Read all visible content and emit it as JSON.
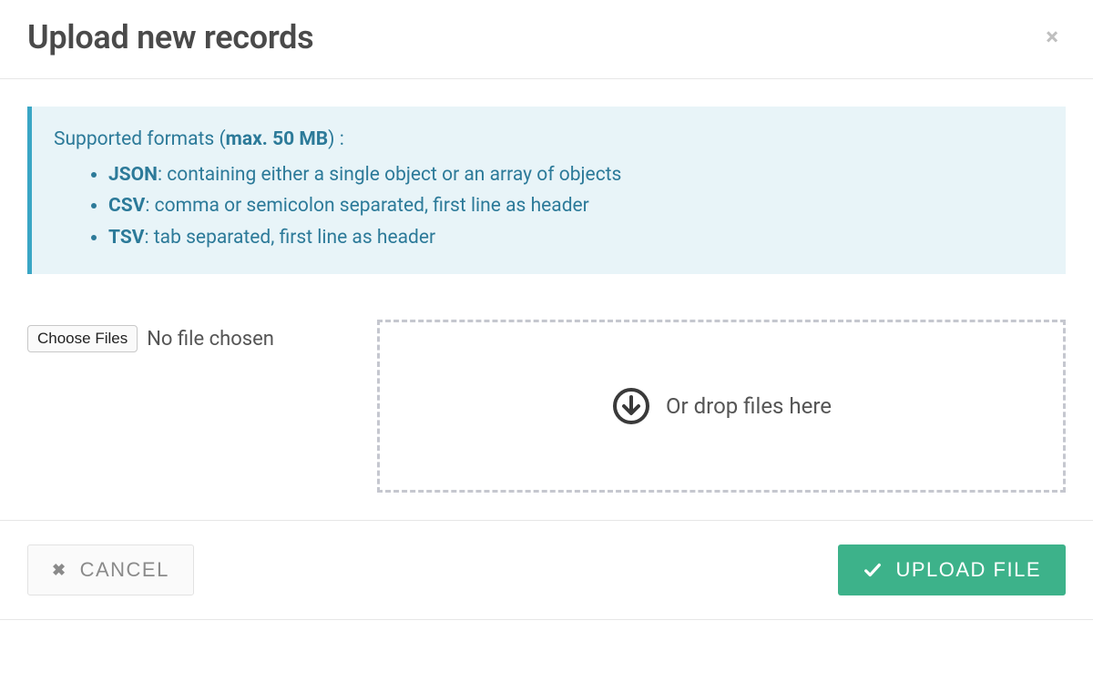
{
  "modal": {
    "title": "Upload new records",
    "close_label": "×"
  },
  "info": {
    "supported_prefix": "Supported formats (",
    "max_size": "max. 50 MB",
    "supported_suffix": ") :",
    "formats": [
      {
        "name": "JSON",
        "desc": ": containing either a single object or an array of objects"
      },
      {
        "name": "CSV",
        "desc": ": comma or semicolon separated, first line as header"
      },
      {
        "name": "TSV",
        "desc": ": tab separated, first line as header"
      }
    ]
  },
  "upload": {
    "choose_button": "Choose Files",
    "no_file_text": "No file chosen",
    "dropzone_text": "Or drop files here"
  },
  "footer": {
    "cancel_label": "CANCEL",
    "upload_label": "UPLOAD FILE"
  },
  "colors": {
    "accent_info": "#3aa6c5",
    "info_bg": "#e8f4f8",
    "primary": "#3db28a",
    "muted_border": "#c5c7cf"
  }
}
